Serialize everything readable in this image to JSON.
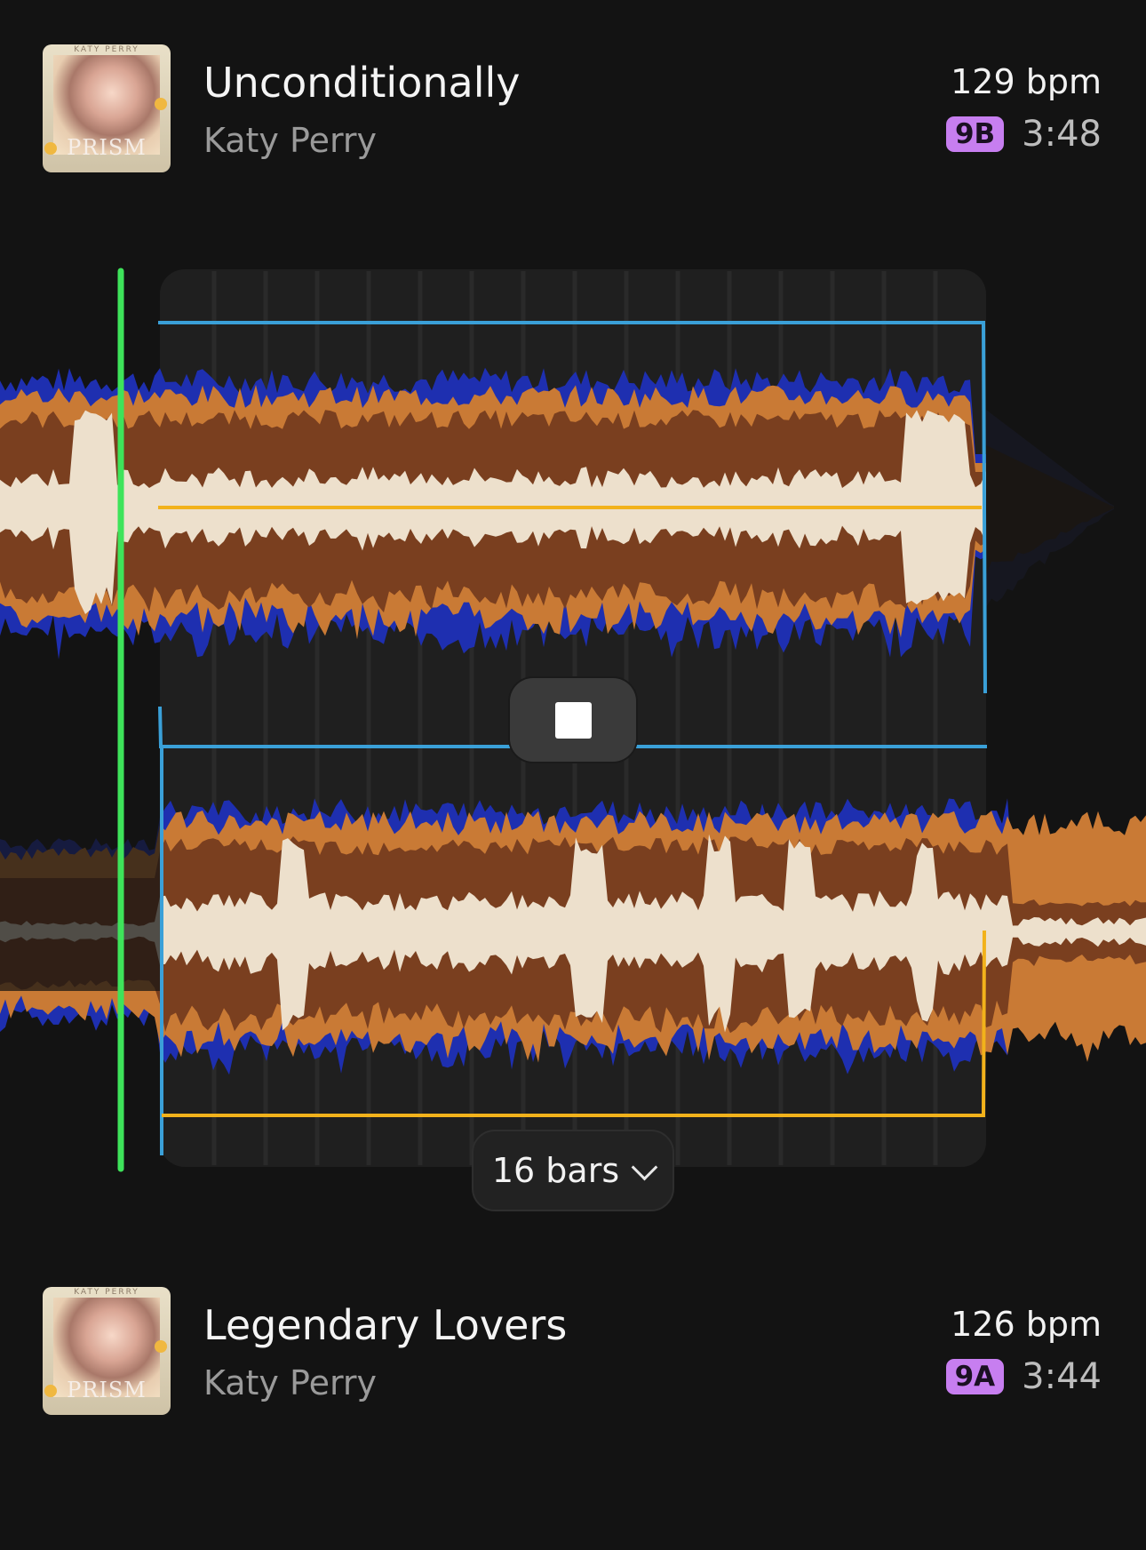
{
  "tracks": [
    {
      "title": "Unconditionally",
      "artist": "Katy Perry",
      "bpm": "129 bpm",
      "key": "9B",
      "duration": "3:48",
      "cover": {
        "top_text": "KATY PERRY",
        "label": "PRISM"
      }
    },
    {
      "title": "Legendary Lovers",
      "artist": "Katy Perry",
      "bpm": "126 bpm",
      "key": "9A",
      "duration": "3:44",
      "cover": {
        "top_text": "KATY PERRY",
        "label": "PRISM"
      }
    }
  ],
  "transition": {
    "stop_icon": "stop-icon",
    "length_label": "16 bars",
    "length_icon": "chevron-down-icon"
  },
  "colors": {
    "background": "#131313",
    "panel": "#1f1f1f",
    "playhead": "#3ee35a",
    "bracket_blue": "#3aa0d8",
    "bracket_yellow": "#f2b21b",
    "wave_dark_brown": "#7a3f1f",
    "wave_light_orange": "#c97a35",
    "wave_blue": "#1e2fb0",
    "wave_cream": "#ede0cc",
    "key_badge": "#c77ef0"
  }
}
